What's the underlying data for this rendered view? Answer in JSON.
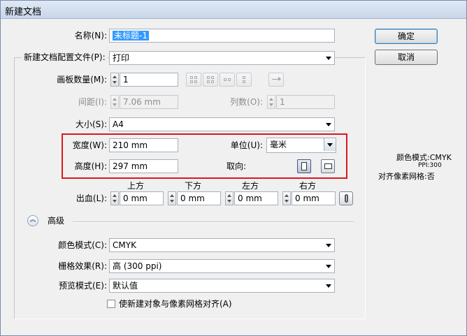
{
  "window": {
    "title": "新建文档"
  },
  "buttons": {
    "ok": "确定",
    "cancel": "取消"
  },
  "fields": {
    "name": {
      "label": "名称(N):",
      "value": "未标题-1"
    },
    "profile": {
      "label": "新建文档配置文件(P):",
      "value": "打印"
    },
    "artboards": {
      "label": "画板数量(M):",
      "value": "1"
    },
    "spacing": {
      "label": "间距(I):",
      "value": "7.06 mm"
    },
    "columns": {
      "label": "列数(O):",
      "value": "1"
    },
    "size": {
      "label": "大小(S):",
      "value": "A4"
    },
    "width": {
      "label": "宽度(W):",
      "value": "210 mm"
    },
    "height": {
      "label": "高度(H):",
      "value": "297 mm"
    },
    "units": {
      "label": "单位(U):",
      "value": "毫米"
    },
    "orientation": {
      "label": "取向:",
      "selected": "portrait"
    },
    "bleed": {
      "label": "出血(L):",
      "top": {
        "label": "上方",
        "value": "0 mm"
      },
      "bottom": {
        "label": "下方",
        "value": "0 mm"
      },
      "left": {
        "label": "左方",
        "value": "0 mm"
      },
      "right": {
        "label": "右方",
        "value": "0 mm"
      }
    }
  },
  "advanced": {
    "label": "高级",
    "color_mode": {
      "label": "颜色模式(C):",
      "value": "CMYK"
    },
    "raster": {
      "label": "栅格效果(R):",
      "value": "高 (300 ppi)"
    },
    "preview": {
      "label": "预览模式(E):",
      "value": "默认值"
    },
    "align_checkbox": {
      "label": "使新建对象与像素网格对齐(A)",
      "checked": false
    }
  },
  "info": {
    "color_mode": "颜色模式:CMYK",
    "ppi": "PPI:300",
    "pixel_grid": "对齐像素网格:否"
  },
  "colors": {
    "highlight": "#d9181e",
    "selection": "#3399ff"
  }
}
